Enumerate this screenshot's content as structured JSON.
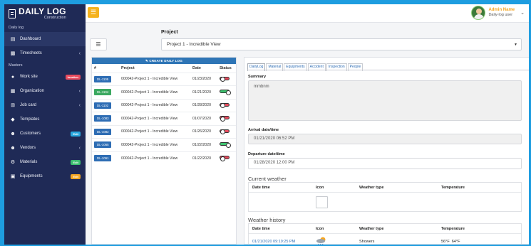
{
  "brand": {
    "title": "DAILY LOG",
    "subtitle": "Construction"
  },
  "sidebar": {
    "section_daily": "Daily log",
    "section_masters": "Masters",
    "items": [
      {
        "label": "Dashboard",
        "icon": "dashboard-icon"
      },
      {
        "label": "Timesheets",
        "icon": "calendar-icon"
      },
      {
        "label": "Work site",
        "icon": "location-icon",
        "badge": "location"
      },
      {
        "label": "Organization",
        "icon": "building-icon"
      },
      {
        "label": "Job card",
        "icon": "plus-square-icon"
      },
      {
        "label": "Templates",
        "icon": "tags-icon"
      },
      {
        "label": "Customers",
        "icon": "user-icon",
        "badge": "Edit"
      },
      {
        "label": "Vendors",
        "icon": "user-icon"
      },
      {
        "label": "Materials",
        "icon": "cogs-icon",
        "badge": "Edit"
      },
      {
        "label": "Equipments",
        "icon": "truck-icon",
        "badge": "Edit"
      }
    ]
  },
  "user": {
    "name": "Admin Name",
    "role": "Daily-log user"
  },
  "project": {
    "label": "Project",
    "selected": "Project 1 - Incredible View"
  },
  "logs": {
    "create_label": "CREATE DAILY LOG",
    "headers": [
      "#",
      "Project",
      "Date",
      "Status"
    ],
    "rows": [
      {
        "code": "DL-1105",
        "project": "000042-Project 1 - Incredible View",
        "date": "01/23/2020",
        "status": "off",
        "color": "blue"
      },
      {
        "code": "DL-1104",
        "project": "000042-Project 1 - Incredible View",
        "date": "01/21/2020",
        "status": "on",
        "color": "green"
      },
      {
        "code": "DL-1102",
        "project": "000042-Project 1 - Incredible View",
        "date": "01/28/2020",
        "status": "off",
        "color": "blue"
      },
      {
        "code": "DL-1083",
        "project": "000042-Project 1 - Incredible View",
        "date": "01/07/2020",
        "status": "off",
        "color": "blue"
      },
      {
        "code": "DL-1082",
        "project": "000042-Project 1 - Incredible View",
        "date": "01/26/2020",
        "status": "off",
        "color": "blue"
      },
      {
        "code": "DL-1065",
        "project": "000042-Project 1 - Incredible View",
        "date": "01/22/2020",
        "status": "on",
        "color": "blue"
      },
      {
        "code": "DL-1061",
        "project": "000042-Project 1 - Incredible View",
        "date": "01/22/2020",
        "status": "off",
        "color": "blue"
      }
    ]
  },
  "tabs": [
    "DailyLog",
    "Material",
    "Equipments",
    "Accident",
    "Inspection",
    "People"
  ],
  "detail": {
    "summary_label": "Summary",
    "summary_value": "mmbnm",
    "arrival_label": "Arrival date/time",
    "arrival_value": "01/21/2020 06:52 PM",
    "departure_label": "Departure date/time",
    "departure_value": "01/28/2020 12:00 PM",
    "current_weather": "Current weather",
    "weather_history": "Weather history",
    "weather_headers": [
      "Date time",
      "Icon",
      "Weather type",
      "Temperature"
    ],
    "history_row": {
      "datetime": "01/21/2020 09:19:25 PM",
      "type": "Showers",
      "temp_high": "56°F",
      "temp_low": "64°F"
    }
  }
}
